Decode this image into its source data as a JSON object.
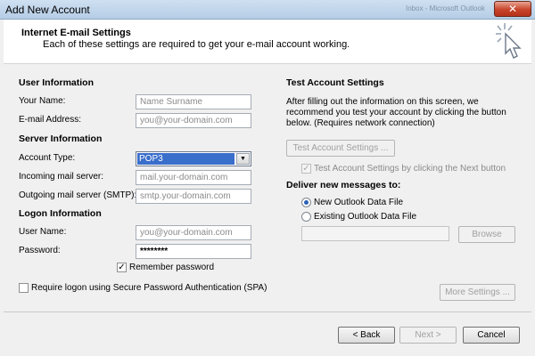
{
  "window": {
    "title": "Add New Account",
    "background_title": "Inbox - Microsoft Outlook",
    "close_glyph": "✕"
  },
  "header": {
    "title": "Internet E-mail Settings",
    "subtitle": "Each of these settings are required to get your e-mail account working."
  },
  "user_info": {
    "section": "User Information",
    "name_label": "Your Name:",
    "name_placeholder": "Name Surname",
    "email_label": "E-mail Address:",
    "email_placeholder": "you@your-domain.com"
  },
  "server_info": {
    "section": "Server Information",
    "account_type_label": "Account Type:",
    "account_type_value": "POP3",
    "incoming_label": "Incoming mail server:",
    "incoming_placeholder": "mail.your-domain.com",
    "outgoing_label": "Outgoing mail server (SMTP):",
    "outgoing_placeholder": "smtp.your-domain.com"
  },
  "logon_info": {
    "section": "Logon Information",
    "username_label": "User Name:",
    "username_placeholder": "you@your-domain.com",
    "password_label": "Password:",
    "password_value": "********",
    "remember_label": "Remember password",
    "remember_checked": true,
    "spa_label": "Require logon using Secure Password Authentication (SPA)",
    "spa_checked": false
  },
  "test_settings": {
    "section": "Test Account Settings",
    "description_line1": "After filling out the information on this screen, we",
    "description_line2": "recommend you test your account by clicking the button",
    "description_line3": "below. (Requires network connection)",
    "test_button": "Test Account Settings ...",
    "auto_test_label": "Test Account Settings by clicking the Next button",
    "auto_test_checked": true
  },
  "deliver": {
    "section": "Deliver new messages to:",
    "new_file_label": "New Outlook Data File",
    "existing_file_label": "Existing Outlook Data File",
    "selected": "new",
    "path_value": "",
    "browse_button": "Browse"
  },
  "more_settings_button": "More Settings ...",
  "footer": {
    "back_button": "< Back",
    "next_button": "Next >",
    "cancel_button": "Cancel"
  },
  "check_glyph": "✓",
  "dropdown_glyph": "▼"
}
